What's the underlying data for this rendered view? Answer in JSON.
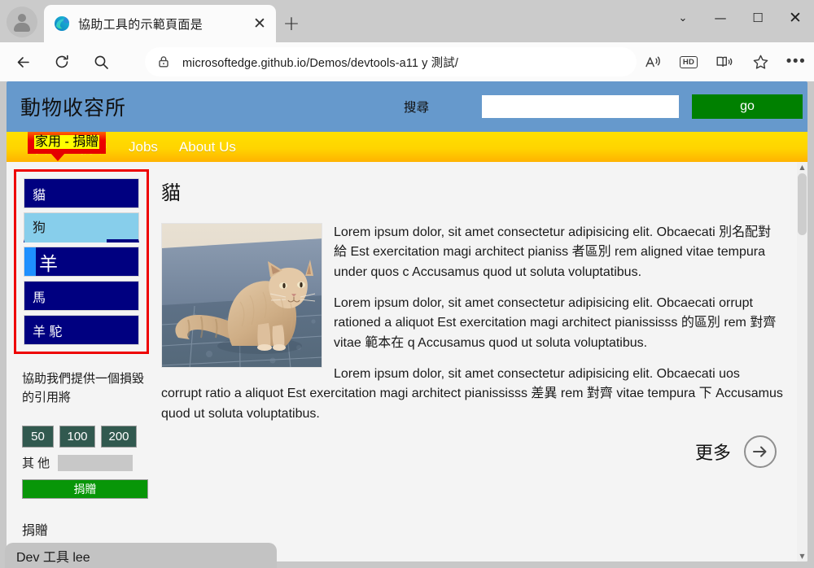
{
  "browser": {
    "tab": {
      "title": "協助工具的示範頁面是",
      "favicon": "edge-logo-icon",
      "close_label": "✕"
    },
    "newtab_label": "+",
    "window_controls": {
      "tab_search": "⌄",
      "minimize": "—",
      "maximize": "☐",
      "close": "✕"
    },
    "toolbar": {
      "back": "back-arrow-icon",
      "refresh": "refresh-icon",
      "search": "search-icon",
      "url": "microsoftedge.github.io/Demos/devtools-a11 y 測試/",
      "lock": "lock-icon",
      "read_aloud": "read-aloud-icon",
      "hd_badge": "HD",
      "immersive_reader": "immersive-reader-icon",
      "favorites": "star-icon",
      "settings_more": "•••"
    }
  },
  "page": {
    "header": {
      "site_title": "動物收容所",
      "search_label": "搜尋",
      "search_value": "",
      "search_placeholder": "",
      "go_button": "go",
      "bg_color": "#6699cc",
      "go_color": "#008000"
    },
    "nav": {
      "badge_text": "家用 - 捐贈",
      "badge_color": "#e40000",
      "links": [
        {
          "label": "家用",
          "faint": true
        },
        {
          "label": "捐贈",
          "faint": true
        },
        {
          "label": "Jobs",
          "faint": false
        },
        {
          "label": "About Us",
          "faint": false
        }
      ]
    },
    "sidebar": {
      "outline_color": "#ee0000",
      "animals": [
        {
          "label": "貓",
          "state": "normal"
        },
        {
          "label": "狗",
          "state": "selected"
        },
        {
          "label": "羊",
          "state": "accent"
        },
        {
          "label": "馬",
          "state": "normal"
        },
        {
          "label": "羊 駝",
          "state": "normal"
        }
      ],
      "donate": {
        "lead": "協助我們提供一個損毀的引用將",
        "amounts": [
          "50",
          "100",
          "200"
        ],
        "other_label": "其 他",
        "other_value": "",
        "donate_button": "捐贈",
        "footer": "捐贈"
      }
    },
    "main": {
      "title": "貓",
      "image_alt": "cat-photo",
      "paragraphs": [
        "Lorem ipsum dolor, sit amet consectetur adipisicing elit. Obcaecati 別名配對給 Est exercitation magi architect pianiss 者區別 rem aligned vitae tempura under quos c Accusamus quod ut soluta voluptatibus.",
        "Lorem ipsum dolor, sit amet consectetur adipisicing elit. Obcaecati orrupt rationed a aliquot Est exercitation magi architect pianississs 的區別 rem 對齊 vitae 範本在 q Accusamus quod ut soluta voluptatibus.",
        "Lorem ipsum dolor, sit amet consectetur adipisicing elit. Obcaecati uos corrupt ratio a aliquot Est exercitation magi architect pianississs 差異 rem 對齊 vitae tempura 下 Accusamus quod ut soluta voluptatibus."
      ],
      "more_label": "更多",
      "more_icon": "circle-arrow-right-icon"
    },
    "statusbar": "Dev 工具 lee"
  }
}
